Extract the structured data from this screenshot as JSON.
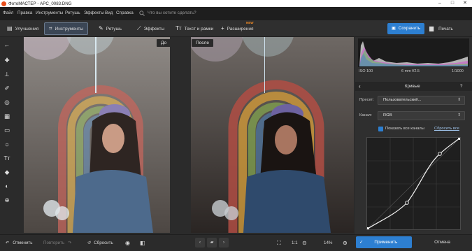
{
  "window": {
    "title": "ФотоМАСТЕР - APC_0083.DNG",
    "controls": [
      "minimize-icon",
      "maximize-icon",
      "close-icon"
    ]
  },
  "menu": {
    "items": [
      "Файл",
      "Правка",
      "Инструменты",
      "Ретушь",
      "Эффекты",
      "Вид",
      "Справка"
    ],
    "search_placeholder": "Что вы хотите сделать?"
  },
  "toolbar": {
    "tabs": [
      {
        "label": "Улучшения",
        "icon": "enhance-icon"
      },
      {
        "label": "Инструменты",
        "icon": "crop-icon",
        "active": true
      },
      {
        "label": "Ретушь",
        "icon": "brush-icon"
      },
      {
        "label": "Эффекты",
        "icon": "magic-wand-icon"
      },
      {
        "label": "Текст и рамки",
        "icon": "text-icon"
      },
      {
        "label": "Расширения",
        "icon": "plus-icon",
        "badge": "NEW"
      }
    ],
    "save_label": "Сохранить",
    "print_label": "Печать"
  },
  "compare": {
    "before_label": "До",
    "after_label": "После"
  },
  "histogram": {
    "iso": "ISO 100",
    "lens": "6 mm f/2.5",
    "shutter": "1/1000"
  },
  "curves": {
    "title": "Кривые",
    "help": "?",
    "preset_label": "Пресет:",
    "preset_value": "Пользовательский...",
    "channel_label": "Канал:",
    "channel_value": "RGB",
    "show_all_label": "Показать все каналы",
    "reset_all_label": "Сбросить все"
  },
  "bottom": {
    "undo_label": "Отменить",
    "redo_label": "Повторить",
    "reset_label": "Сбросить",
    "zoom_ratio": "1:1",
    "zoom_percent": "14%",
    "apply_label": "Применить",
    "cancel_label": "Отмена"
  },
  "colors": {
    "accent": "#2d7fd1",
    "badge": "#f08a24",
    "background": "#2b2b2b"
  }
}
